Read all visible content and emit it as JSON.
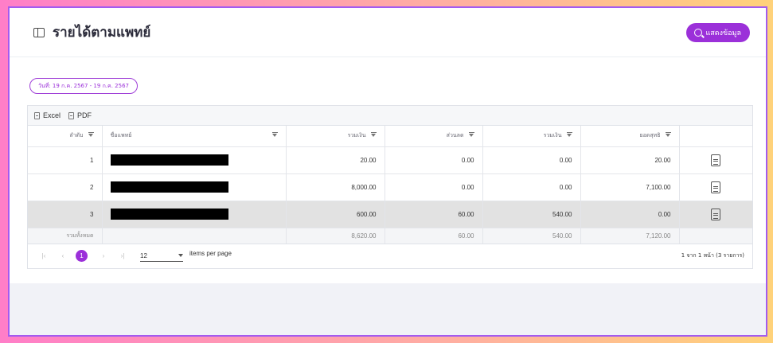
{
  "header": {
    "title": "รายได้ตามแพทย์",
    "show_button_label": "แสดงข้อมูล"
  },
  "filter": {
    "date_range": "วันที่: 19 ก.ค. 2567 - 19 ก.ค. 2567"
  },
  "toolbar": {
    "excel_label": "Excel",
    "pdf_label": "PDF"
  },
  "table": {
    "columns": [
      "ลำดับ",
      "ชื่อแพทย์",
      "รวมเงิน",
      "ส่วนลด",
      "รวมเงิน",
      "ยอดสุทธิ"
    ],
    "rows": [
      {
        "no": "1",
        "total": "20.00",
        "discount": "0.00",
        "net_total": "0.00",
        "balance": "20.00"
      },
      {
        "no": "2",
        "total": "8,000.00",
        "discount": "0.00",
        "net_total": "0.00",
        "balance": "7,100.00"
      },
      {
        "no": "3",
        "total": "600.00",
        "discount": "60.00",
        "net_total": "540.00",
        "balance": "0.00"
      }
    ],
    "footer": {
      "label": "รวมทั้งหมด",
      "total": "8,620.00",
      "discount": "60.00",
      "net_total": "540.00",
      "balance": "7,120.00"
    }
  },
  "pager": {
    "current_page": "1",
    "page_size": "12",
    "items_per_page_label": "items per page",
    "info": "1 จาก 1 หน้า (3 รายการ)"
  }
}
